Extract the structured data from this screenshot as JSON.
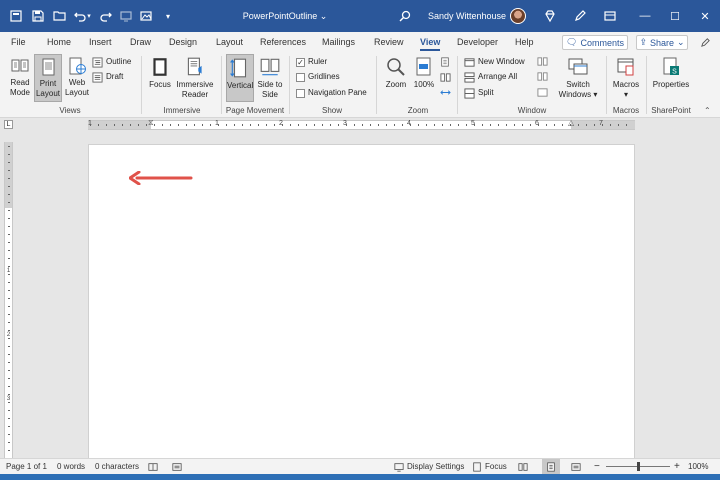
{
  "titlebar": {
    "doc_title": "PowerPointOutline",
    "user_name": "Sandy Wittenhouse"
  },
  "tabs": [
    "File",
    "Home",
    "Insert",
    "Draw",
    "Design",
    "Layout",
    "References",
    "Mailings",
    "Review",
    "View",
    "Developer",
    "Help"
  ],
  "active_tab": "View",
  "header_buttons": {
    "comments": "Comments",
    "share": "Share"
  },
  "ribbon": {
    "views": {
      "label": "Views",
      "read_mode": "Read Mode",
      "print_layout": "Print Layout",
      "web_layout": "Web Layout",
      "outline": "Outline",
      "draft": "Draft"
    },
    "immersive": {
      "label": "Immersive",
      "focus": "Focus",
      "immersive_reader": "Immersive Reader"
    },
    "page_movement": {
      "label": "Page Movement",
      "vertical": "Vertical",
      "side_to_side": "Side to Side"
    },
    "show": {
      "label": "Show",
      "ruler": "Ruler",
      "ruler_checked": true,
      "gridlines": "Gridlines",
      "gridlines_checked": false,
      "navigation_pane": "Navigation Pane",
      "navigation_pane_checked": false
    },
    "zoom": {
      "label": "Zoom",
      "zoom": "Zoom",
      "hundred": "100%"
    },
    "window": {
      "label": "Window",
      "new_window": "New Window",
      "arrange_all": "Arrange All",
      "split": "Split",
      "switch_windows": "Switch Windows"
    },
    "macros": {
      "label": "Macros",
      "macros": "Macros"
    },
    "sharepoint": {
      "label": "SharePoint",
      "properties": "Properties"
    }
  },
  "ruler": {
    "h_numbers": [
      "1",
      "1",
      "2",
      "3",
      "4",
      "5",
      "6",
      "7"
    ],
    "v_numbers": [
      "1",
      "2",
      "3"
    ]
  },
  "statusbar": {
    "page": "Page 1 of 1",
    "words": "0 words",
    "characters": "0 characters",
    "display_settings": "Display Settings",
    "focus": "Focus",
    "zoom_pct": "100%",
    "zoom_level": 1.0
  },
  "colors": {
    "title_bar": "#2b579a",
    "accent": "#2b579a",
    "arrow": "#e0524a"
  }
}
